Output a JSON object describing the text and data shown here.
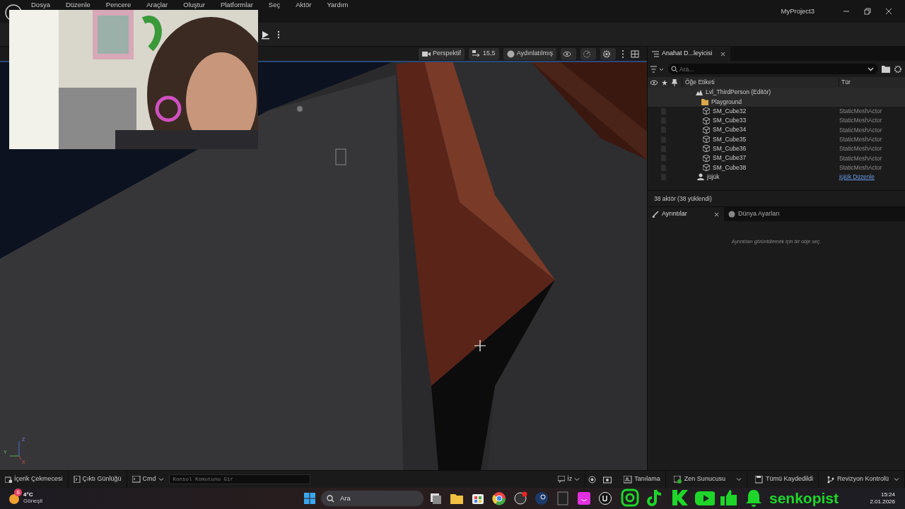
{
  "window": {
    "title": "MyProject3"
  },
  "menu": [
    "Dosya",
    "Düzenle",
    "Pencere",
    "Araçlar",
    "Oluştur",
    "Platformlar",
    "Seç",
    "Aktör",
    "Yardım"
  ],
  "viewport_toolbar": {
    "view_mode": "Perspektif",
    "camera_speed": "15,5",
    "lighting": "Aydınlatılmış"
  },
  "axis_gizmo": [
    "Z",
    "Y",
    "X"
  ],
  "outliner": {
    "tab": "Anahat D...leyicisi",
    "search_placeholder": "Ara...",
    "columns": [
      "Öğe Etiketi",
      "Tür"
    ],
    "rows": [
      {
        "kind": "level",
        "label": "Lvl_ThirdPerson (Editör)",
        "children": [
          {
            "kind": "folder",
            "label": "Playground",
            "children": [
              {
                "kind": "mesh",
                "label": "SM_Cube32",
                "type": "StaticMeshActor"
              },
              {
                "kind": "mesh",
                "label": "SM_Cube33",
                "type": "StaticMeshActor"
              },
              {
                "kind": "mesh",
                "label": "SM_Cube34",
                "type": "StaticMeshActor"
              },
              {
                "kind": "mesh",
                "label": "SM_Cube35",
                "type": "StaticMeshActor"
              },
              {
                "kind": "mesh",
                "label": "SM_Cube36",
                "type": "StaticMeshActor"
              },
              {
                "kind": "mesh",
                "label": "SM_Cube37",
                "type": "StaticMeshActor"
              },
              {
                "kind": "mesh",
                "label": "SM_Cube38",
                "type": "StaticMeshActor"
              }
            ]
          },
          {
            "kind": "pawn",
            "label": "jüjük",
            "type": "jüjük Düzenle"
          }
        ]
      }
    ],
    "status": "38 aktör (38 yüklendi)"
  },
  "details": {
    "tabs": [
      {
        "label": "Ayrıntılar",
        "selected": true
      },
      {
        "label": "Dünya Ayarları",
        "selected": false
      }
    ],
    "empty_message": "Ayrıntıları görüntülemek için bir obje seç."
  },
  "status_bar": {
    "left": [
      "İçerik Çekmecesi",
      "Çıktı Günlüğü"
    ],
    "cmd": "Cmd",
    "console_placeholder": "Konsol Komutunu Gir",
    "trace": "İz",
    "right": [
      "Tanılama",
      "Zen Sunucusu",
      "Tümü Kaydedildi",
      "Revizyon Kontrolü"
    ]
  },
  "taskbar": {
    "weather": {
      "badge": "S",
      "temp": "4°C",
      "condition": "Güneşli"
    },
    "search": "Ara",
    "time": "15:24",
    "date": "2.01.2026"
  },
  "stream_overlay": {
    "handle": "senkopist"
  }
}
